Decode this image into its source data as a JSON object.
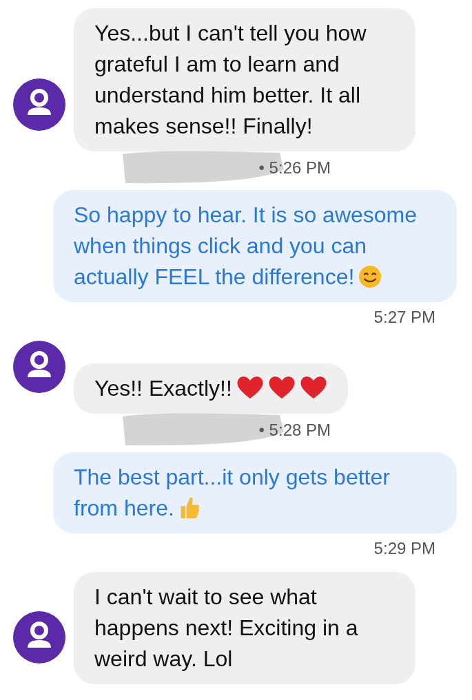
{
  "messages": [
    {
      "kind": "received",
      "text": "Yes...but I can't tell you how grateful I am to learn and understand him better. It all makes sense!! Finally!"
    },
    {
      "kind": "meta",
      "text": "• 5:26 PM",
      "redacted": true
    },
    {
      "kind": "sent",
      "text": "So happy to hear. It is so awesome when things click and you can actually FEEL the difference!",
      "emojis": [
        {
          "kind": "smile"
        }
      ]
    },
    {
      "kind": "time",
      "text": "5:27 PM"
    },
    {
      "kind": "received",
      "text": "Yes!! Exactly!!",
      "emojis": [
        {
          "kind": "heart"
        },
        {
          "kind": "heart"
        },
        {
          "kind": "heart"
        }
      ]
    },
    {
      "kind": "meta",
      "text": "• 5:28 PM",
      "redacted": true
    },
    {
      "kind": "sent",
      "text": "The best part...it only gets better from here.",
      "emojis": [
        {
          "kind": "thumbs-up"
        }
      ]
    },
    {
      "kind": "time",
      "text": "5:29 PM"
    },
    {
      "kind": "received",
      "text": "I can't wait to see what happens next! Exciting in a weird way. Lol"
    }
  ]
}
